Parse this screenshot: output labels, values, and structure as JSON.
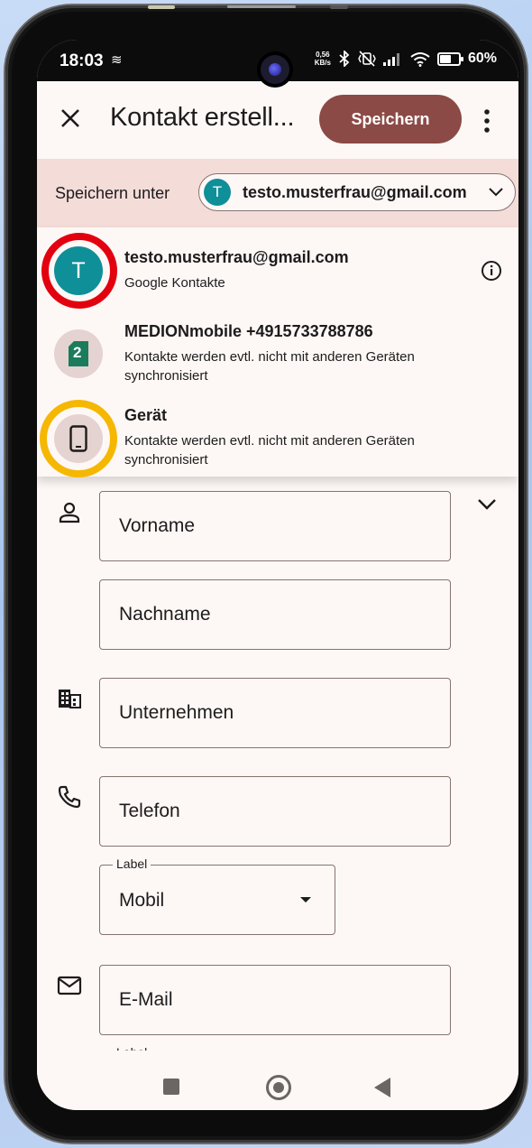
{
  "statusbar": {
    "time": "18:03",
    "sync_glyph": "≋",
    "speed_top": "0,56",
    "speed_bottom": "KB/s",
    "battery": "60%"
  },
  "appbar": {
    "title": "Kontakt erstell...",
    "save_label": "Speichern"
  },
  "save_under": {
    "label": "Speichern unter",
    "account_initial": "T",
    "account": "testo.musterfrau@gmail.com"
  },
  "accounts": [
    {
      "initial": "T",
      "title": "testo.musterfrau@gmail.com",
      "subtitle": "Google Kontakte",
      "highlight_color": "#e3000f"
    },
    {
      "sim_number": "2",
      "title": "MEDIONmobile +4915733788786",
      "subtitle": "Kontakte werden evtl. nicht mit anderen Geräten synchronisiert"
    },
    {
      "title": "Gerät",
      "subtitle": "Kontakte werden evtl. nicht mit anderen Geräten synchronisiert",
      "highlight_color": "#f6b700"
    }
  ],
  "form": {
    "first_name": "Vorname",
    "last_name": "Nachname",
    "company": "Unternehmen",
    "phone": "Telefon",
    "phone_label_legend": "Label",
    "phone_label_value": "Mobil",
    "email": "E-Mail",
    "email_label_legend": "Label"
  },
  "colors": {
    "accent": "#8b4a45",
    "teal_avatar": "#0f8f98",
    "banner": "#f4dcd9"
  }
}
